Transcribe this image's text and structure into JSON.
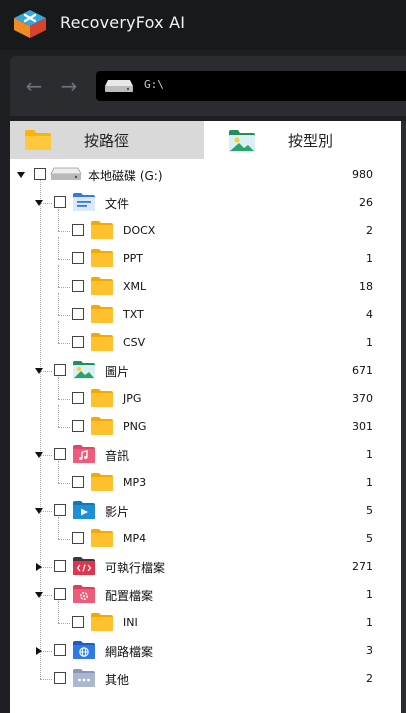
{
  "app": {
    "title": "RecoveryFox AI"
  },
  "nav": {
    "back_icon": "arrow-left-icon",
    "forward_icon": "arrow-right-icon",
    "address": "G:\\"
  },
  "tabs": [
    {
      "label": "按路徑",
      "icon": "folder-icon",
      "active": false
    },
    {
      "label": "按型別",
      "icon": "image-file-icon",
      "active": true
    }
  ],
  "tree": [
    {
      "label": "本地磁碟 (G:)",
      "count": "980",
      "level": 0,
      "icon": "drive",
      "expander": "down"
    },
    {
      "label": "文件",
      "count": "26",
      "level": 1,
      "icon": "docs",
      "expander": "down"
    },
    {
      "label": "DOCX",
      "count": "2",
      "level": 2,
      "icon": "folder",
      "expander": ""
    },
    {
      "label": "PPT",
      "count": "1",
      "level": 2,
      "icon": "folder",
      "expander": ""
    },
    {
      "label": "XML",
      "count": "18",
      "level": 2,
      "icon": "folder",
      "expander": ""
    },
    {
      "label": "TXT",
      "count": "4",
      "level": 2,
      "icon": "folder",
      "expander": ""
    },
    {
      "label": "CSV",
      "count": "1",
      "level": 2,
      "icon": "folder",
      "expander": ""
    },
    {
      "label": "圖片",
      "count": "671",
      "level": 1,
      "icon": "images",
      "expander": "down"
    },
    {
      "label": "JPG",
      "count": "370",
      "level": 2,
      "icon": "folder",
      "expander": ""
    },
    {
      "label": "PNG",
      "count": "301",
      "level": 2,
      "icon": "folder",
      "expander": ""
    },
    {
      "label": "音訊",
      "count": "1",
      "level": 1,
      "icon": "audio",
      "expander": "down"
    },
    {
      "label": "MP3",
      "count": "1",
      "level": 2,
      "icon": "folder",
      "expander": ""
    },
    {
      "label": "影片",
      "count": "5",
      "level": 1,
      "icon": "video",
      "expander": "down"
    },
    {
      "label": "MP4",
      "count": "5",
      "level": 2,
      "icon": "folder",
      "expander": ""
    },
    {
      "label": "可執行檔案",
      "count": "271",
      "level": 1,
      "icon": "exec",
      "expander": "right"
    },
    {
      "label": "配置檔案",
      "count": "1",
      "level": 1,
      "icon": "config",
      "expander": "down"
    },
    {
      "label": "INI",
      "count": "1",
      "level": 2,
      "icon": "folder",
      "expander": ""
    },
    {
      "label": "網路檔案",
      "count": "3",
      "level": 1,
      "icon": "network",
      "expander": "right"
    },
    {
      "label": "其他",
      "count": "2",
      "level": 1,
      "icon": "other",
      "expander": ""
    }
  ],
  "colors": {
    "folder": "#ffc22e",
    "docs": "#2f7ae5",
    "images": "#2aa46a",
    "audio": "#f25a7b",
    "video": "#1d8fd8",
    "exec": "#e2344e",
    "config": "#ef5b7a",
    "network": "#2f7ae5",
    "other": "#a9b7cf"
  }
}
